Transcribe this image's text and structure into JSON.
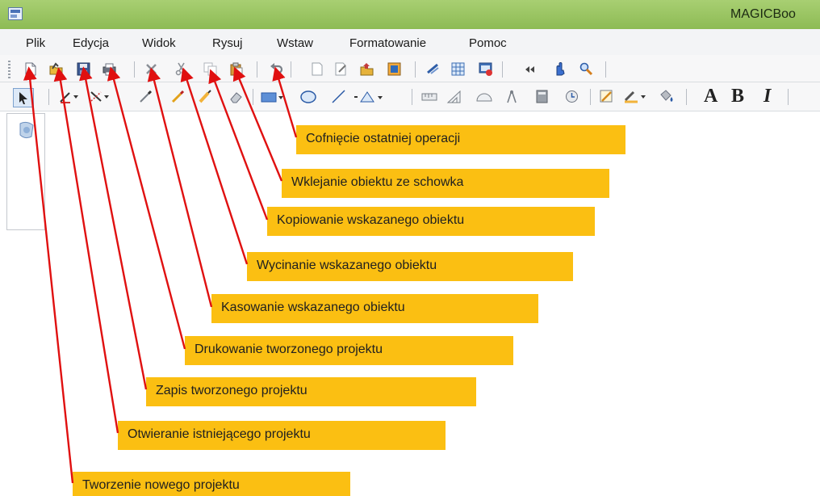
{
  "window": {
    "title": "MAGICBoo"
  },
  "menu": [
    "Plik",
    "Edycja",
    "Widok",
    "Rysuj",
    "Wstaw",
    "Formatowanie",
    "Pomoc"
  ],
  "toolbar_text": {
    "bold": "A",
    "bold2": "B",
    "italic": "I"
  },
  "callouts": [
    "Cofnięcie ostatniej operacji",
    "Wklejanie obiektu ze schowka",
    "Kopiowanie wskazanego obiektu",
    "Wycinanie wskazanego obiektu",
    "Kasowanie wskazanego obiektu",
    "Drukowanie tworzonego projektu",
    "Zapis tworzonego projektu",
    "Otwieranie istniejącego projektu",
    "Tworzenie nowego projektu"
  ],
  "colors": {
    "titlebar": "#8dbb54",
    "callout": "#fbbf12",
    "arrow": "#e01010"
  }
}
